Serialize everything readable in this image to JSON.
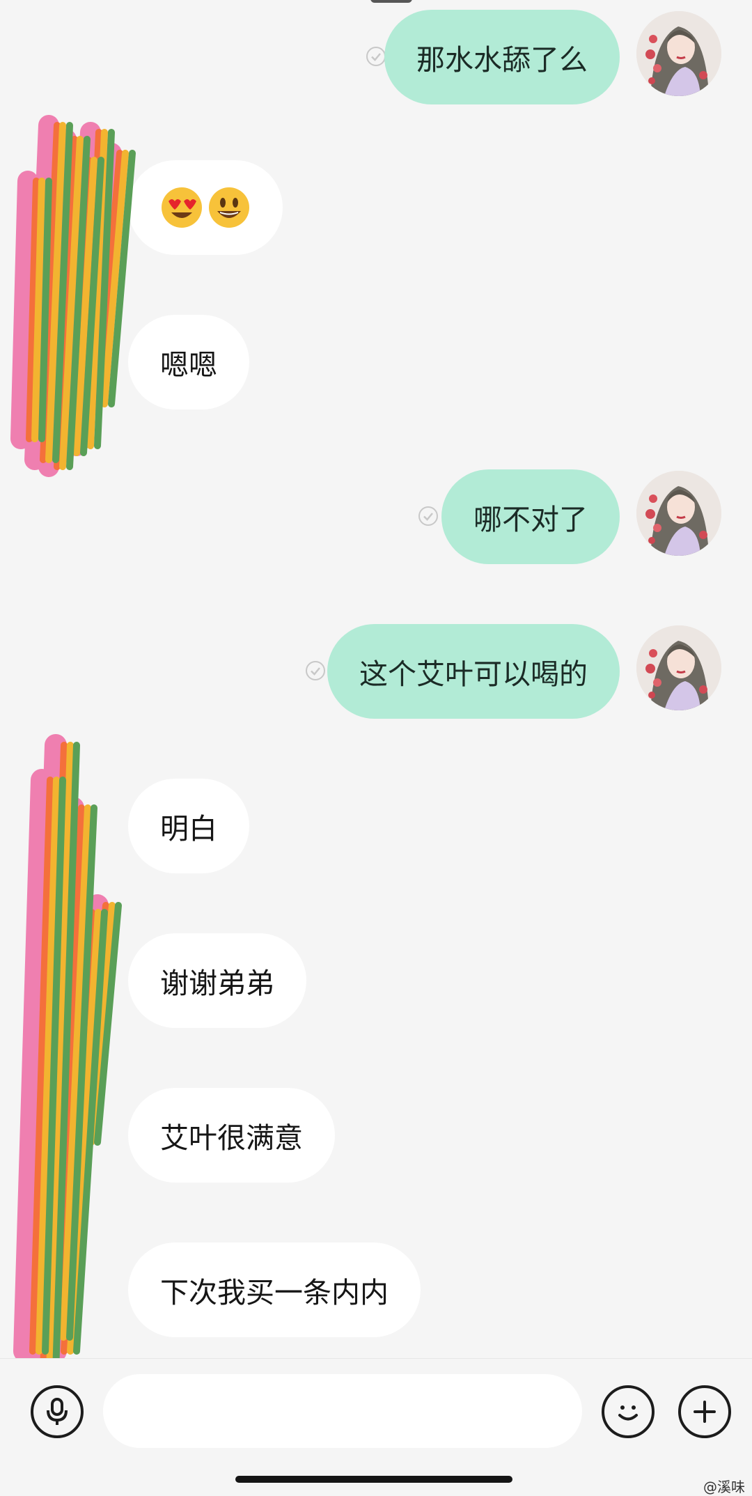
{
  "messages": [
    {
      "type": "sent",
      "text": "那水水舔了么"
    },
    {
      "type": "recv",
      "text": "😍😃"
    },
    {
      "type": "recv",
      "text": "嗯嗯"
    },
    {
      "type": "sent",
      "text": "哪不对了"
    },
    {
      "type": "sent",
      "text": "这个艾叶可以喝的"
    },
    {
      "type": "recv",
      "text": "明白"
    },
    {
      "type": "recv",
      "text": "谢谢弟弟"
    },
    {
      "type": "recv",
      "text": "艾叶很满意"
    },
    {
      "type": "recv",
      "text": "下次我买一条内内"
    }
  ],
  "input_bar": {
    "placeholder": "",
    "left_icon": "microphone-icon",
    "right_icons": [
      "emoji-icon",
      "plus-icon"
    ]
  },
  "watermark": "@溪味",
  "colors": {
    "background": "#f5f5f5",
    "sent_bubble": "#b2ebd6",
    "recv_bubble": "#ffffff",
    "scribble_pink": "#ef7fb0",
    "scribble_orange": "#f4703b",
    "scribble_yellow": "#f2b430",
    "scribble_green": "#5a9f57"
  }
}
